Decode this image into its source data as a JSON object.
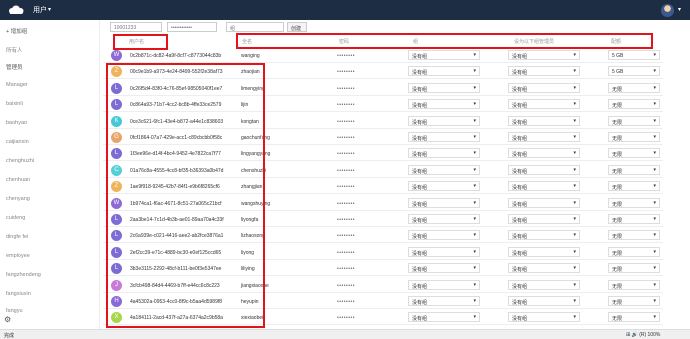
{
  "topbar": {
    "app_name": "用户",
    "caret": "▾",
    "avatar_caret": "▾"
  },
  "controls": {
    "username_value": "10001233",
    "password_value": "••••••••••••",
    "group_value": "组",
    "create_label": "创建"
  },
  "sidebar": {
    "new_group": "+ 增加组",
    "items": [
      "所有人",
      "管理员",
      "Manager",
      "baixinli",
      "baohyao",
      "caijianxin",
      "chenghuzhi",
      "chenhuan",
      "chenyang",
      "cuideng",
      "dingfe fei",
      "employee",
      "fangzhendeng",
      "fangxiuxin",
      "fangyu"
    ]
  },
  "headers": {
    "username": "用户名",
    "display_name": "全名",
    "password": "密码",
    "groups": "组",
    "subadmin": "设为以下组管理员",
    "quota": "配额"
  },
  "rows": [
    {
      "letter": "W",
      "color": "#8d6ad6",
      "uid": "0c2b871c-dc82-4a9f-8cf7-c8773044c83b",
      "name": "wanging",
      "group": "没有组",
      "sub": "没有组",
      "quota": "5 GB"
    },
    {
      "letter": "Z",
      "color": "#f0b35a",
      "uid": "00c9e1b9-a973-4e24-8499-552f2e38af73",
      "name": "zhaojian",
      "group": "没有组",
      "sub": "没有组",
      "quota": "5 GB"
    },
    {
      "letter": "L",
      "color": "#7d6bd6",
      "uid": "0c26f5d4-83f0-4c76-85ef-98505040f1ee7",
      "name": "limengying",
      "group": "没有组",
      "sub": "没有组",
      "quota": "无限"
    },
    {
      "letter": "L",
      "color": "#7d6bd6",
      "uid": "0c864a93-71b7-4cc2-bc8b-4ffe33ce2579",
      "name": "lijin",
      "group": "没有组",
      "sub": "没有组",
      "quota": "无限"
    },
    {
      "letter": "K",
      "color": "#45c8d8",
      "uid": "0ce3c621-6fc1-43e4-b872-a44e1c838603",
      "name": "kongtan",
      "group": "没有组",
      "sub": "没有组",
      "quota": "无限"
    },
    {
      "letter": "G",
      "color": "#e8a56a",
      "uid": "0fcf1864-07a7-429e-acc1-c89cbcbb0f58c",
      "name": "gaochunfang",
      "group": "没有组",
      "sub": "没有组",
      "quota": "无限"
    },
    {
      "letter": "L",
      "color": "#7d6bd6",
      "uid": "1f3ee96e-d14f-4bc4-9452-4e7822ca7f77",
      "name": "lingyangyang",
      "group": "没有组",
      "sub": "没有组",
      "quota": "无限"
    },
    {
      "letter": "C",
      "color": "#56cfd8",
      "uid": "01a76c8a-4555-4cc8-bf35-b36393a0b47d",
      "name": "chenshuzhi",
      "group": "没有组",
      "sub": "没有组",
      "quota": "无限"
    },
    {
      "letter": "Z",
      "color": "#f0b35a",
      "uid": "1ae9f918-9245-42b7-84f1-e9b6f8265cf6",
      "name": "zhangjian",
      "group": "没有组",
      "sub": "没有组",
      "quota": "无限"
    },
    {
      "letter": "W",
      "color": "#8d6ad6",
      "uid": "1b974ca1-f6ac-4671-8c51-27a065c21bcf",
      "name": "wangshuying",
      "group": "没有组",
      "sub": "没有组",
      "quota": "无限"
    },
    {
      "letter": "L",
      "color": "#7d6bd6",
      "uid": "2aa3be14-7c1d-4b3b-ae01-89aa70a4c33f",
      "name": "liyongfa",
      "group": "没有组",
      "sub": "没有组",
      "quota": "无限"
    },
    {
      "letter": "L",
      "color": "#7d6bd6",
      "uid": "2c6a939e-c021-4416-aee2-ab2fce3876a1",
      "name": "lizhaosong",
      "group": "没有组",
      "sub": "没有组",
      "quota": "无限"
    },
    {
      "letter": "L",
      "color": "#7d6bd6",
      "uid": "2ef2cc39-e71c-4889-bc30-e0ef125ccd65",
      "name": "liyong",
      "group": "没有组",
      "sub": "没有组",
      "quota": "无限"
    },
    {
      "letter": "L",
      "color": "#7d6bd6",
      "uid": "3b3e3115-2292-48cf-b111-be0f3e5347ee",
      "name": "liliying",
      "group": "没有组",
      "sub": "没有组",
      "quota": "无限"
    },
    {
      "letter": "J",
      "color": "#c97ad6",
      "uid": "3cfcb498-84d4-4469-b7ff-e44cc6c8c223",
      "name": "jiangxiaoxue",
      "group": "没有组",
      "sub": "没有组",
      "quota": "无限"
    },
    {
      "letter": "H",
      "color": "#8b6ad6",
      "uid": "4a45302a-0953-4cc0-8f9c-b5aa4d5989f8",
      "name": "heyupin",
      "group": "没有组",
      "sub": "没有组",
      "quota": "无限"
    },
    {
      "letter": "X",
      "color": "#a8d64a",
      "uid": "4a184111-2acd-437f-a27a-6374a2c9b58a",
      "name": "xiexiaobei",
      "group": "没有组",
      "sub": "没有组",
      "quota": "无限"
    }
  ],
  "password_mask": "••••••••",
  "select_caret": "▾",
  "status": {
    "left": "完成",
    "right": "⊞ 🔊 (R) 100%"
  }
}
